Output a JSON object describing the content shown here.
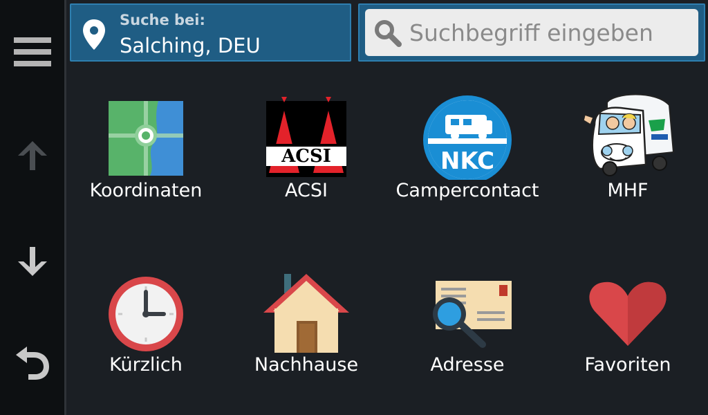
{
  "rail": {
    "menu_icon": "hamburger-menu-icon",
    "up_icon": "arrow-up-icon",
    "down_icon": "arrow-down-icon",
    "back_icon": "back-arrow-icon"
  },
  "location": {
    "label": "Suche bei:",
    "value": "Salching, DEU",
    "icon": "location-pin-icon"
  },
  "search": {
    "placeholder": "Suchbegriff eingeben",
    "icon": "search-icon"
  },
  "categories": [
    {
      "label": "Koordinaten",
      "icon": "coordinates-map-icon"
    },
    {
      "label": "ACSI",
      "icon": "acsi-logo-icon",
      "logo_text": "ACSI"
    },
    {
      "label": "Campercontact",
      "icon": "campercontact-logo-icon",
      "logo_text": "NKC"
    },
    {
      "label": "MHF",
      "icon": "camper-van-icon"
    },
    {
      "label": "Kürzlich",
      "icon": "clock-icon"
    },
    {
      "label": "Nachhause",
      "icon": "house-icon"
    },
    {
      "label": "Adresse",
      "icon": "address-envelope-icon"
    },
    {
      "label": "Favoriten",
      "icon": "heart-icon"
    }
  ],
  "colors": {
    "background": "#1b1f24",
    "rail": "#0d1012",
    "accent_blue": "#1f5d84",
    "search_field": "#ececec"
  }
}
